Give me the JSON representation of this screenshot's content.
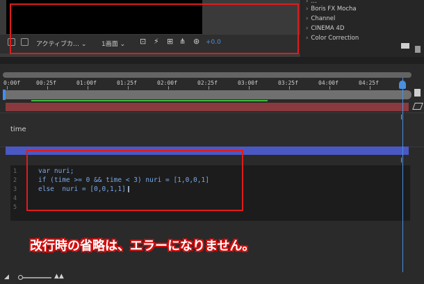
{
  "toolbar": {
    "camera_select": "アクティブカ…",
    "view_select": "1画面",
    "exposure_value": "+0.0"
  },
  "effects_panel": {
    "items": [
      "Boris FX Mocha",
      "Channel",
      "CINEMA 4D",
      "Color Correction"
    ]
  },
  "timeline": {
    "ruler_labels": [
      "0:00f",
      "00:25f",
      "01:00f",
      "01:25f",
      "02:00f",
      "02:25f",
      "03:00f",
      "03:25f",
      "04:00f",
      "04:25f"
    ],
    "expression_property": "time"
  },
  "expression_editor": {
    "line_numbers": [
      "1",
      "2",
      "3",
      "4",
      "5"
    ],
    "lines": [
      "var nuri;",
      "if (time >= 0 && time < 3) nuri = [1,0,0,1]",
      "else  nuri = [0,0,1,1]",
      "",
      ""
    ]
  },
  "annotation": {
    "caption": "改行時の省略は、エラーになりません。",
    "highlight_color": "#e01c1c"
  },
  "colors": {
    "playhead": "#4a8fe0",
    "layer_bar_red": "#8a3a3e",
    "layer_bar_blue": "#4a58c4",
    "code_text": "#7aa9e8"
  }
}
